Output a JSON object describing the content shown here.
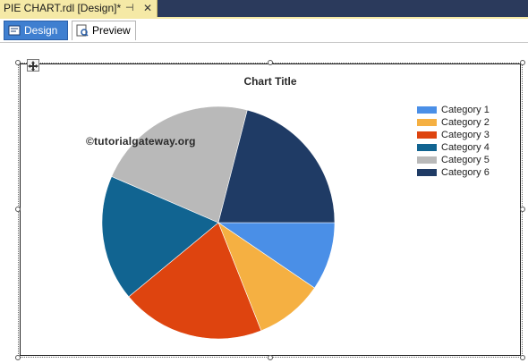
{
  "document_tab": {
    "title": "PIE CHART.rdl [Design]*",
    "pin_icon": "pin-icon",
    "close_glyph": "✕"
  },
  "view_tabs": {
    "design_label": "Design",
    "preview_label": "Preview",
    "active": "Design"
  },
  "watermark": "©tutorialgateway.org",
  "chart_data": {
    "type": "pie",
    "title": "Chart Title",
    "legend_position": "top-right",
    "categories": [
      "Category 1",
      "Category 2",
      "Category 3",
      "Category 4",
      "Category 5",
      "Category 6"
    ],
    "values": [
      9.5,
      9.5,
      20,
      17.5,
      22.5,
      21
    ],
    "colors": [
      "#4a8fe7",
      "#f5b042",
      "#de440f",
      "#116491",
      "#b9b9b9",
      "#1f3b65"
    ]
  }
}
